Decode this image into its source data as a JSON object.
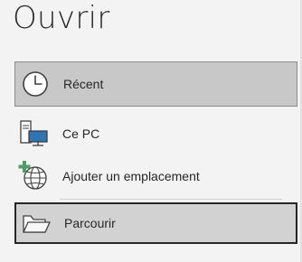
{
  "page": {
    "title": "Ouvrir"
  },
  "nav": {
    "items": [
      {
        "label": "Récent",
        "icon": "clock-icon",
        "state": "selected"
      },
      {
        "label": "Ce PC",
        "icon": "computer-icon",
        "state": "normal"
      },
      {
        "label": "Ajouter un emplacement",
        "icon": "add-place-globe-icon",
        "state": "normal"
      },
      {
        "label": "Parcourir",
        "icon": "folder-open-icon",
        "state": "focused"
      }
    ]
  },
  "colors": {
    "background": "#f3f3f3",
    "selected_bg": "#c8c8c8",
    "focused_bg": "#d2d2d2",
    "icon_blue": "#2e75b6",
    "add_green": "#4f9d69",
    "text": "#262626"
  }
}
